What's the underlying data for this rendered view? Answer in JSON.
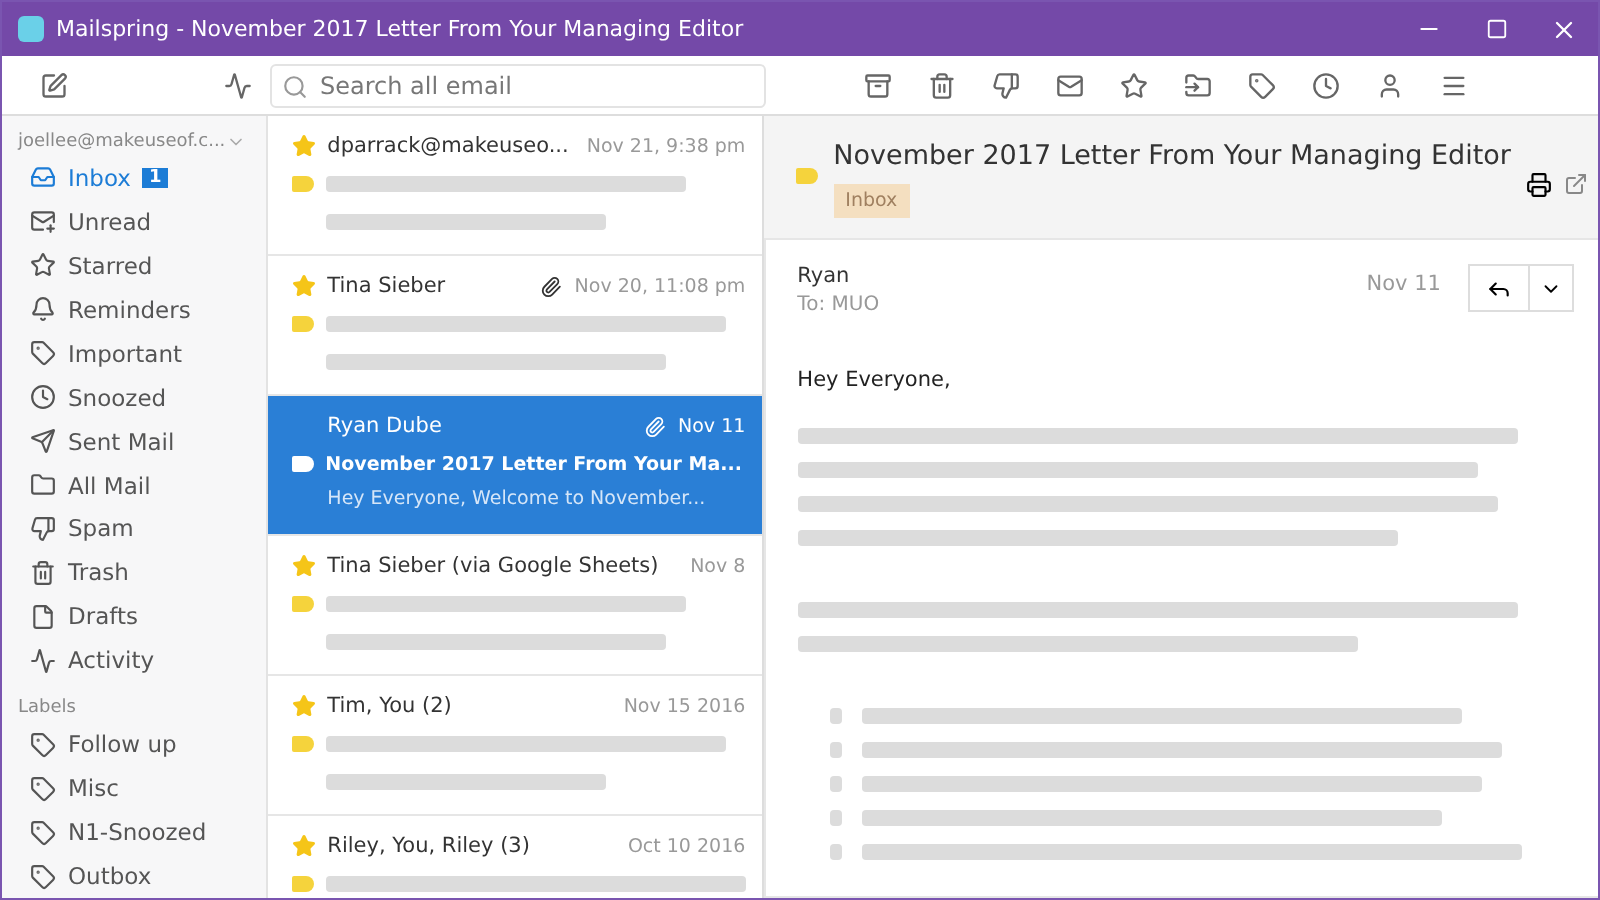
{
  "window": {
    "title": "Mailspring - November 2017 Letter From Your Managing Editor"
  },
  "search": {
    "placeholder": "Search all email"
  },
  "sidebar": {
    "account": "joellee@makeuseof.c...",
    "items": [
      {
        "label": "Inbox",
        "badge": "1",
        "selected": true
      },
      {
        "label": "Unread",
        "selected": false
      },
      {
        "label": "Starred",
        "selected": false
      },
      {
        "label": "Reminders",
        "selected": false
      },
      {
        "label": "Important",
        "selected": false
      },
      {
        "label": "Snoozed",
        "selected": false
      },
      {
        "label": "Sent Mail",
        "selected": false
      },
      {
        "label": "All Mail",
        "selected": false
      },
      {
        "label": "Spam",
        "selected": false
      },
      {
        "label": "Trash",
        "selected": false
      },
      {
        "label": "Drafts",
        "selected": false
      },
      {
        "label": "Activity",
        "selected": false
      }
    ],
    "labels_heading": "Labels",
    "labels": [
      {
        "label": "Follow up",
        "selected": false
      },
      {
        "label": "Misc",
        "selected": false
      },
      {
        "label": "N1-Snoozed",
        "selected": false
      },
      {
        "label": "Outbox",
        "selected": false
      }
    ]
  },
  "messages": [
    {
      "sender": "dparrack@makeuseo...",
      "date": "Nov 21, 9:38 pm",
      "starred": true,
      "attachment": false,
      "selected": false
    },
    {
      "sender": "Tina Sieber",
      "date": "Nov 20, 11:08 pm",
      "starred": true,
      "attachment": true,
      "selected": false
    },
    {
      "sender": "Ryan Dube",
      "date": "Nov 11",
      "subject": "November 2017 Letter From Your Ma...",
      "snippet": "Hey Everyone, Welcome to November...",
      "starred": false,
      "attachment": true,
      "selected": true
    },
    {
      "sender": "Tina Sieber (via Google Sheets)",
      "date": "Nov 8",
      "starred": true,
      "attachment": false,
      "selected": false
    },
    {
      "sender": "Tim, You (2)",
      "date": "Nov 15 2016",
      "starred": true,
      "attachment": false,
      "selected": false
    },
    {
      "sender": "Riley, You, Riley (3)",
      "date": "Oct 10 2016",
      "starred": true,
      "attachment": false,
      "selected": false
    }
  ],
  "reader": {
    "subject": "November 2017 Letter From Your Managing Editor",
    "label": "Inbox",
    "from": "Ryan",
    "to": "To: MUO",
    "date": "Nov 11",
    "greeting": "Hey Everyone,"
  }
}
